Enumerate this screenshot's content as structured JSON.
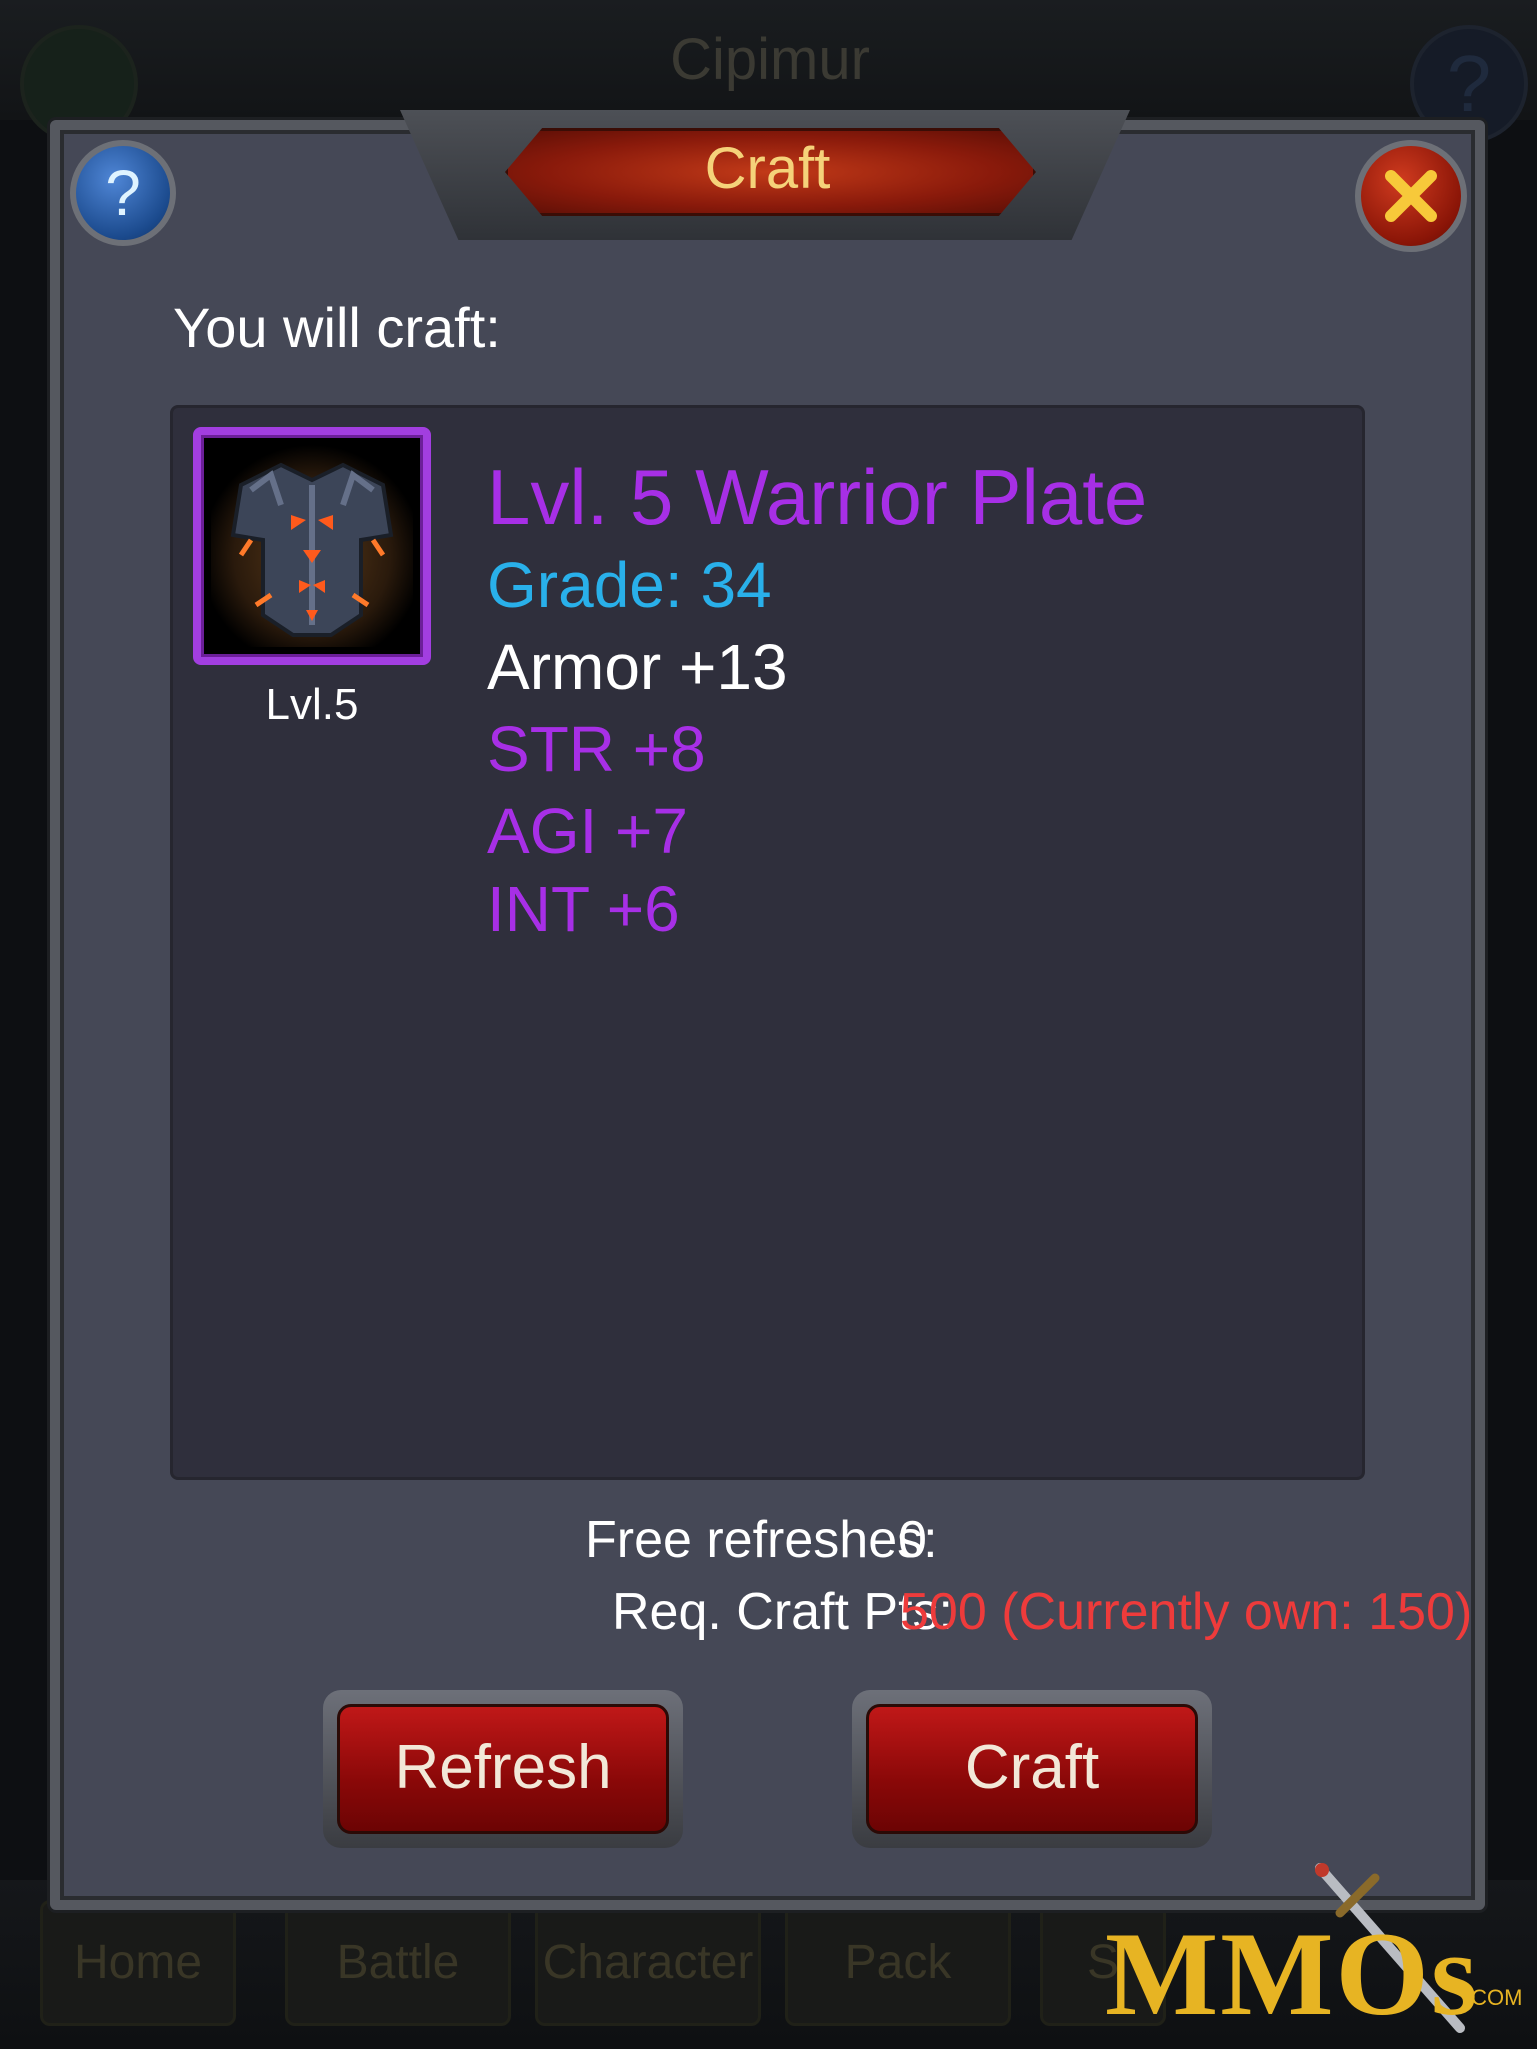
{
  "background": {
    "title": "Cipimur",
    "nav": [
      "Home",
      "Battle",
      "Character",
      "Pack",
      "S"
    ]
  },
  "dialog": {
    "title": "Craft",
    "help_icon": "?",
    "heading": "You will craft:",
    "item": {
      "icon": "warrior-plate-armor-icon",
      "level_label": "Lvl.5",
      "name": "Lvl. 5 Warrior Plate",
      "grade": "Grade: 34",
      "stats": {
        "armor": "Armor +13",
        "str": "STR +8",
        "agi": "AGI +7",
        "int": "INT +6"
      }
    },
    "free_refreshes_label": "Free refreshes:",
    "free_refreshes_value": "0",
    "req_label": "Req. Craft Pts:",
    "req_value": "500 (Currently own: 150)",
    "buttons": {
      "refresh": "Refresh",
      "craft": "Craft"
    }
  },
  "watermark": {
    "logo": "MMOs",
    "suffix": ".COM"
  },
  "colors": {
    "purple_quality": "#a72fe6",
    "grade_blue": "#29b0ea",
    "warning_red": "#ee3b3b",
    "dialog_bg": "#454856",
    "panel_bg": "#2f2f3c"
  }
}
